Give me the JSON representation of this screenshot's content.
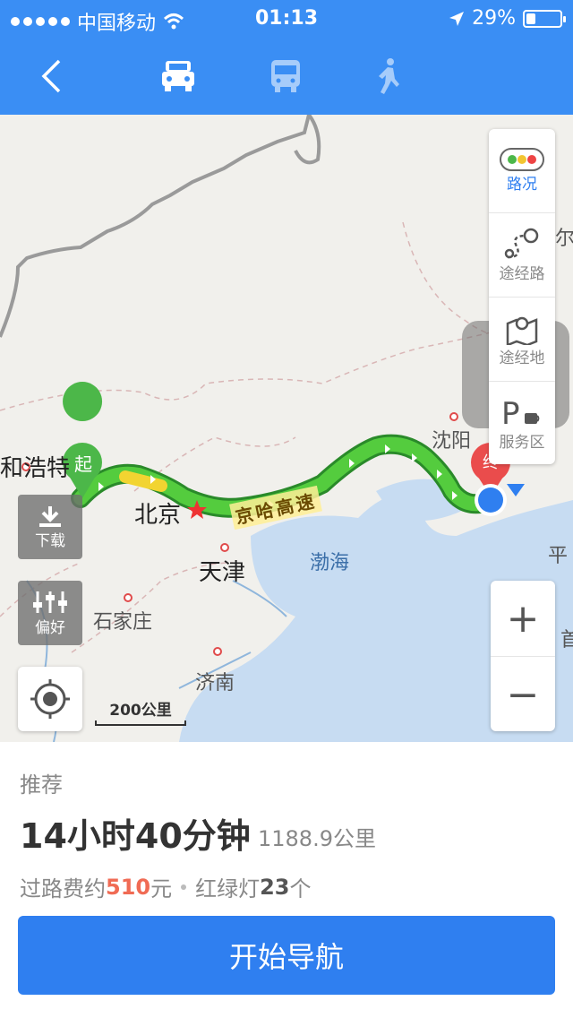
{
  "status_bar": {
    "carrier": "中国移动",
    "time": "01:13",
    "battery": "29%",
    "battery_level": 0.29
  },
  "header": {
    "tabs": [
      "car-icon",
      "bus-icon",
      "walk-icon"
    ],
    "active_tab": "car-icon",
    "accent": "#3a8ef4"
  },
  "map": {
    "cities": [
      "和浩特",
      "北京",
      "天津",
      "石家庄",
      "济南",
      "沈阳",
      "平",
      "尔",
      "首"
    ],
    "sea": "渤海",
    "highway": "京哈高速",
    "start_marker": "起",
    "end_marker": "终",
    "scale": "200公里",
    "side_tools": [
      {
        "label": "路况",
        "icon": "traffic-light-icon"
      },
      {
        "label": "途经路",
        "icon": "via-road-icon"
      },
      {
        "label": "途经地",
        "icon": "via-place-icon"
      },
      {
        "label": "服务区",
        "icon": "service-area-icon"
      }
    ],
    "download_label": "下载",
    "preference_label": "偏好",
    "zoom_in": "+",
    "zoom_out": "−"
  },
  "route": {
    "recommend": "推荐",
    "duration": "14小时40分钟",
    "distance": "1188.9公里",
    "toll_prefix": "过路费约",
    "toll_value": "510",
    "toll_suffix": "元",
    "lights_prefix": "红绿灯",
    "lights_value": "23",
    "lights_suffix": "个",
    "start_button": "开始导航"
  },
  "colors": {
    "primary": "#2f7ff0",
    "route_green": "#3ec13a",
    "toll": "#f06b54"
  }
}
